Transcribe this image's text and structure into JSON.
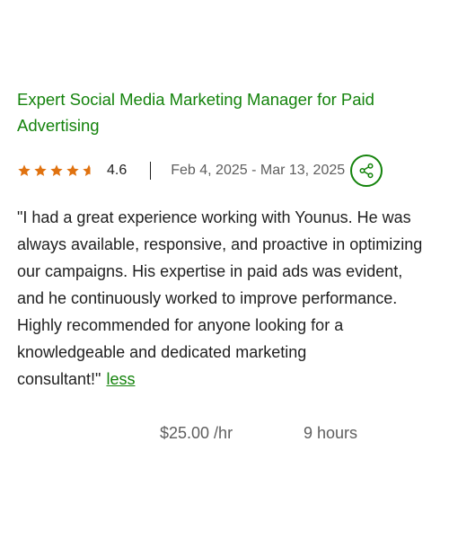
{
  "review": {
    "title": "Expert Social Media Marketing Manager for Paid Advertising",
    "rating": "4.6",
    "rating_fraction": 0.92,
    "date_range": "Feb 4, 2025 - Mar 13, 2025",
    "feedback": "\"I had a great experience working with Younus. He was always available, responsive, and proactive in optimizing our campaigns. His expertise in paid ads was evident, and he continuously worked to improve performance. Highly recommended for anyone looking for a knowledgeable and dedicated marketing consultant!\"",
    "less_label": "less",
    "rate": "$25.00 /hr",
    "hours": "9 hours"
  },
  "icons": {
    "star": "star-icon",
    "share": "share-icon"
  },
  "colors": {
    "accent_green": "#14830c",
    "star_orange": "#e0720f",
    "text_dark": "#1f1f1f",
    "text_muted": "#5e5e5e"
  }
}
